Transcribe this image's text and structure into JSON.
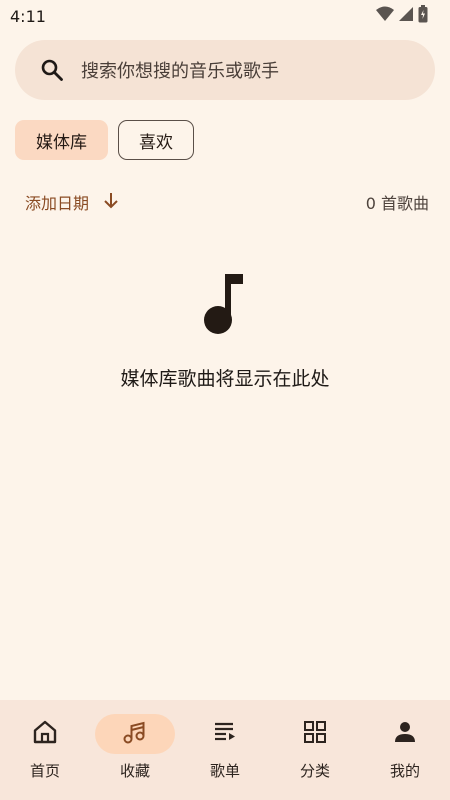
{
  "status_bar": {
    "time": "4:11",
    "icons": [
      "wifi-icon",
      "signal-icon",
      "battery-icon"
    ]
  },
  "search": {
    "placeholder": "搜索你想搜的音乐或歌手",
    "icon": "search-icon"
  },
  "filter_chips": [
    {
      "label": "媒体库",
      "selected": true
    },
    {
      "label": "喜欢",
      "selected": false
    }
  ],
  "sort": {
    "label": "添加日期",
    "direction_icon": "arrow-down-icon",
    "song_count": "0 首歌曲"
  },
  "empty_state": {
    "icon": "music-note-icon",
    "message": "媒体库歌曲将显示在此处"
  },
  "bottom_nav": {
    "items": [
      {
        "label": "首页",
        "icon": "home-icon",
        "active": false
      },
      {
        "label": "收藏",
        "icon": "music-notes-icon",
        "active": true
      },
      {
        "label": "歌单",
        "icon": "playlist-icon",
        "active": false
      },
      {
        "label": "分类",
        "icon": "category-icon",
        "active": false
      },
      {
        "label": "我的",
        "icon": "person-icon",
        "active": false
      }
    ]
  },
  "colors": {
    "background": "#fdf4ea",
    "search_bg": "#f5e3d5",
    "chip_selected": "#fbd9c2",
    "accent_text": "#8a4b23",
    "nav_bg": "#f8e6da",
    "nav_active_pill": "#fdd6b9"
  }
}
